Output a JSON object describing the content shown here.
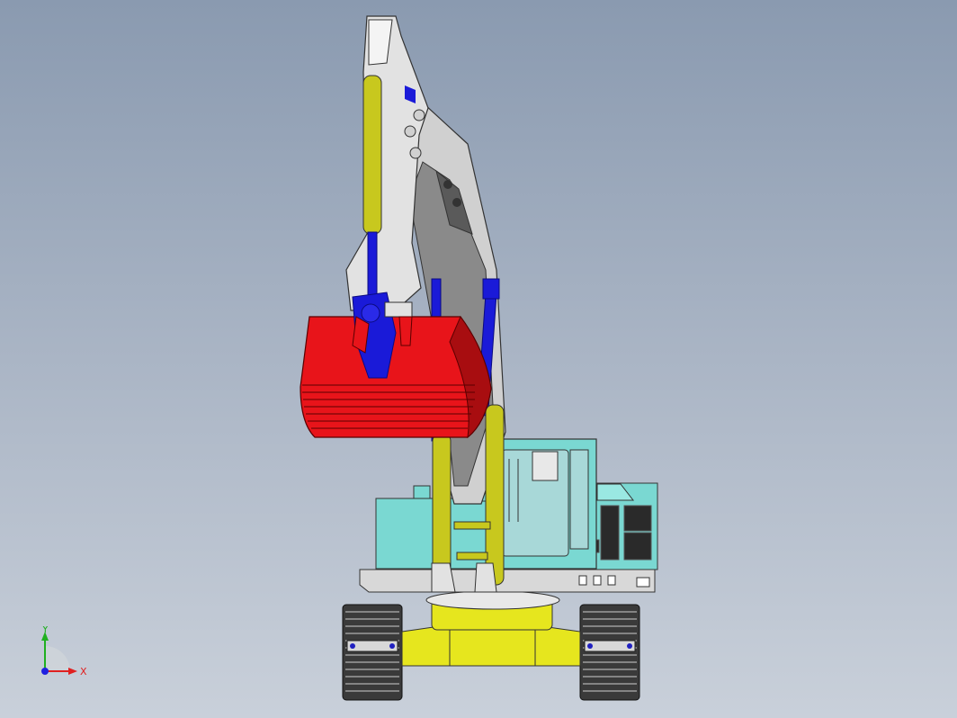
{
  "viewport": {
    "background_top": "#8a9ab0",
    "background_bottom": "#c9d0da"
  },
  "model": {
    "colors": {
      "bucket": "#e8141a",
      "bucket_dark": "#a80d10",
      "cylinder_rod": "#1a1ad8",
      "cylinder_barrel": "#c8c81e",
      "undercarriage": "#e6e61e",
      "cab": "#7ad8d2",
      "boom": "#d0d0d0",
      "track": "#3a3a3a"
    }
  },
  "triad": {
    "x_label": "X",
    "y_label": "Y",
    "x_color": "#e02020",
    "y_color": "#20b020",
    "z_color": "#2020e0"
  }
}
